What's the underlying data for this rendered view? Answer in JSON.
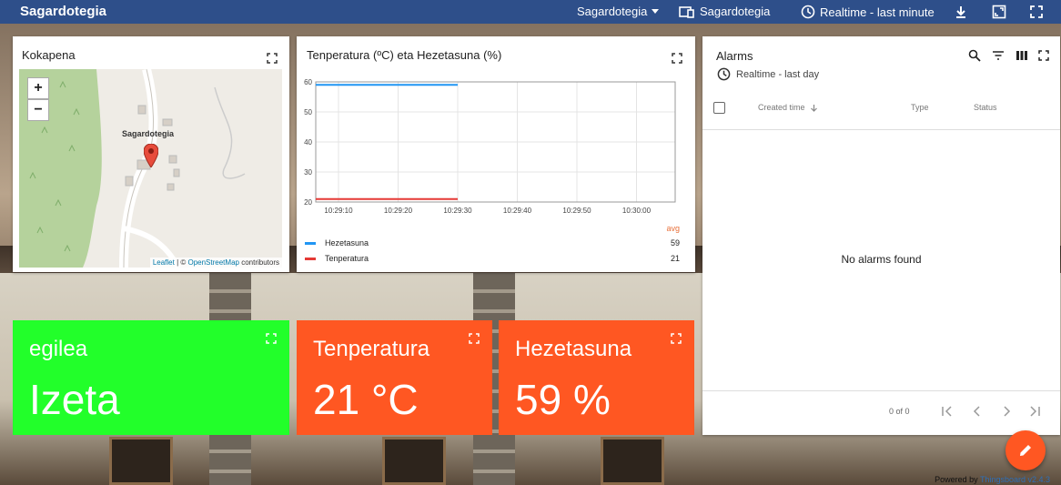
{
  "topbar": {
    "title": "Sagardotegia",
    "state_selector": "Sagardotegia",
    "entity_selector": "Sagardotegia",
    "timewindow": "Realtime - last minute",
    "icons": [
      "chevron-down-icon",
      "device-icon",
      "clock-icon",
      "download-icon",
      "fullscreen-exit-icon",
      "fullscreen-icon"
    ]
  },
  "map_widget": {
    "title": "Kokapena",
    "zoom_in": "+",
    "zoom_out": "−",
    "marker_label": "Sagardotegia",
    "attribution": {
      "leaflet": "Leaflet",
      "separator": " | © ",
      "osm": "OpenStreetMap",
      "suffix": " contributors"
    }
  },
  "chart_widget": {
    "title": "Tenperatura (ºC) eta Hezetasuna (%)",
    "avg_label": "avg",
    "legend": [
      {
        "name": "Hezetasuna",
        "avg": "59",
        "color": "#2196f3"
      },
      {
        "name": "Tenperatura",
        "avg": "21",
        "color": "#e53935"
      }
    ]
  },
  "chart_data": {
    "type": "line",
    "x_ticks": [
      "10:29:10",
      "10:29:20",
      "10:29:30",
      "10:29:40",
      "10:29:50",
      "10:30:00"
    ],
    "y_ticks": [
      20,
      30,
      40,
      50,
      60
    ],
    "ylim": [
      20,
      60
    ],
    "series": [
      {
        "name": "Hezetasuna",
        "x": [
          "10:29:10",
          "10:29:30"
        ],
        "values": [
          59,
          59
        ],
        "color": "#2196f3"
      },
      {
        "name": "Tenperatura",
        "x": [
          "10:29:10",
          "10:29:30"
        ],
        "values": [
          21,
          21
        ],
        "color": "#e53935"
      }
    ],
    "grid": true
  },
  "value_cards": [
    {
      "label": "egilea",
      "value": "Izeta",
      "color": "#22ff2a"
    },
    {
      "label": "Tenperatura",
      "value": "21 °C",
      "color": "#ff5722"
    },
    {
      "label": "Hezetasuna",
      "value": "59 %",
      "color": "#ff5722"
    }
  ],
  "alarms_widget": {
    "title": "Alarms",
    "timewindow": "Realtime - last day",
    "columns": [
      "Created time",
      "Type",
      "Status"
    ],
    "empty_text": "No alarms found",
    "pagination": "0 of 0"
  },
  "footer": {
    "powered_by": "Powered by",
    "brand": "Thingsboard v2.4.3"
  }
}
